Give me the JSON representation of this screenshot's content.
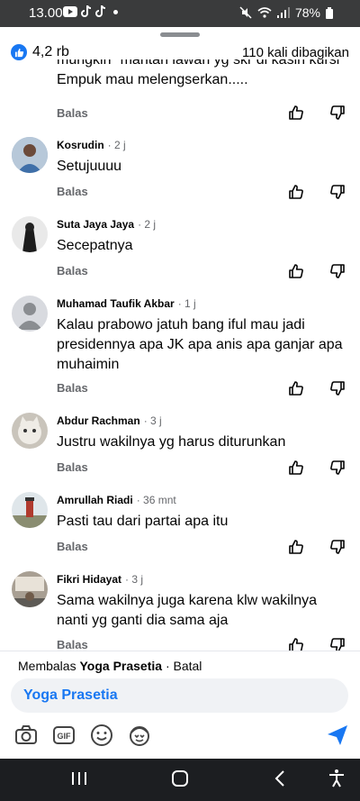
{
  "status_bar": {
    "time": "13.00",
    "battery": "78%"
  },
  "post": {
    "reaction_count": "4,2 rb",
    "share_count": "110 kali dibagikan"
  },
  "comments": [
    {
      "name": "",
      "time": "",
      "text": "mungkin \"mantan lawan yg skr di kasih kursi Empuk mau melengserkan.....",
      "reply": "Balas"
    },
    {
      "name": "Kosrudin",
      "time": "· 2 j",
      "text": "Setujuuuu",
      "reply": "Balas"
    },
    {
      "name": "Suta Jaya Jaya",
      "time": "· 2 j",
      "text": "Secepatnya",
      "reply": "Balas"
    },
    {
      "name": "Muhamad Taufik Akbar",
      "time": "· 1 j",
      "text": "Kalau prabowo jatuh bang iful mau jadi presidennya apa JK apa anis apa ganjar apa muhaimin",
      "reply": "Balas"
    },
    {
      "name": "Abdur Rachman",
      "time": "· 3 j",
      "text": "Justru wakilnya yg harus diturunkan",
      "reply": "Balas"
    },
    {
      "name": "Amrullah Riadi",
      "time": "· 36 mnt",
      "text": "Pasti tau dari partai apa itu",
      "reply": "Balas"
    },
    {
      "name": "Fikri Hidayat",
      "time": "· 3 j",
      "text": "Sama wakilnya juga karena klw wakilnya nanti yg ganti dia sama aja",
      "reply": "Balas"
    }
  ],
  "reply_bar": {
    "replying_prefix": "Membalas",
    "replying_to": "Yoga Prasetia",
    "cancel": "· Batal",
    "input_value": "Yoga Prasetia"
  },
  "icons": {
    "tools": [
      "camera-icon",
      "gif-icon",
      "emoji-icon",
      "avatar-sticker-icon",
      "send-icon"
    ],
    "nav": [
      "recent-apps-icon",
      "home-icon",
      "back-icon",
      "accessibility-icon"
    ]
  },
  "colors": {
    "accent": "#1877f2",
    "muted": "#65676b",
    "status_bar": "#3a3b3c",
    "nav_bar": "#1c1e21"
  }
}
